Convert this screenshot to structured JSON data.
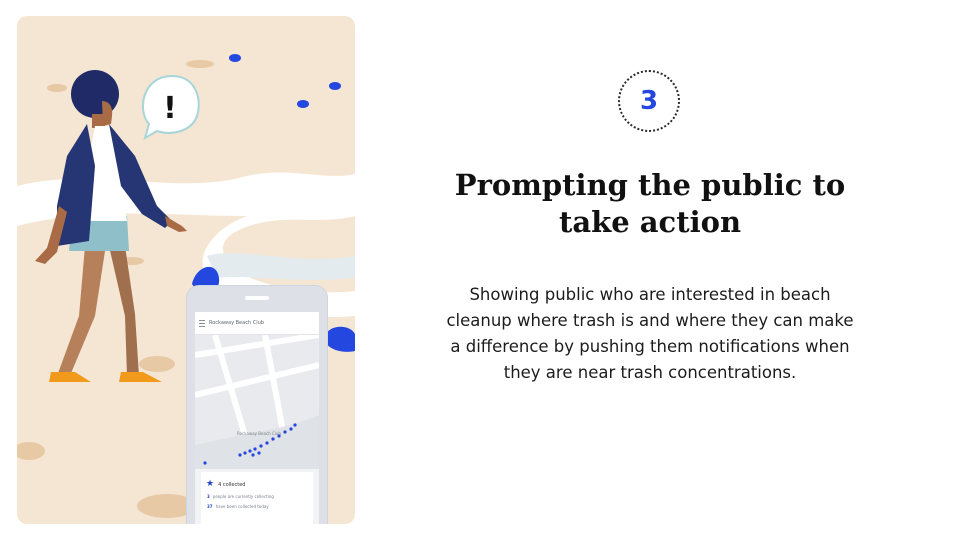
{
  "step": {
    "number": "3"
  },
  "heading": {
    "line1": "Prompting the public to",
    "line2": "take action"
  },
  "body": {
    "line1": "Showing public who are interested in beach",
    "line2": "cleanup where trash is and where they can make",
    "line3": "a difference by pushing them notifications when",
    "line4": "they are near trash concentrations."
  },
  "illustration": {
    "alert_symbol": "!",
    "phone": {
      "app_title": "Rockaway Beach Club",
      "map_label": "Rockaway Beach Club",
      "collected": "4 collected",
      "stat1_num": "3",
      "stat1_text": "people are currently collecting",
      "stat2_num": "37",
      "stat2_text": "have been collected today"
    }
  },
  "colors": {
    "accent_blue": "#2447e0",
    "sand": "#f5e6d3",
    "jacket": "#263574"
  },
  "icons": [
    "exclamation-icon",
    "star-icon",
    "menu-icon",
    "person-icon",
    "trash-icon"
  ]
}
